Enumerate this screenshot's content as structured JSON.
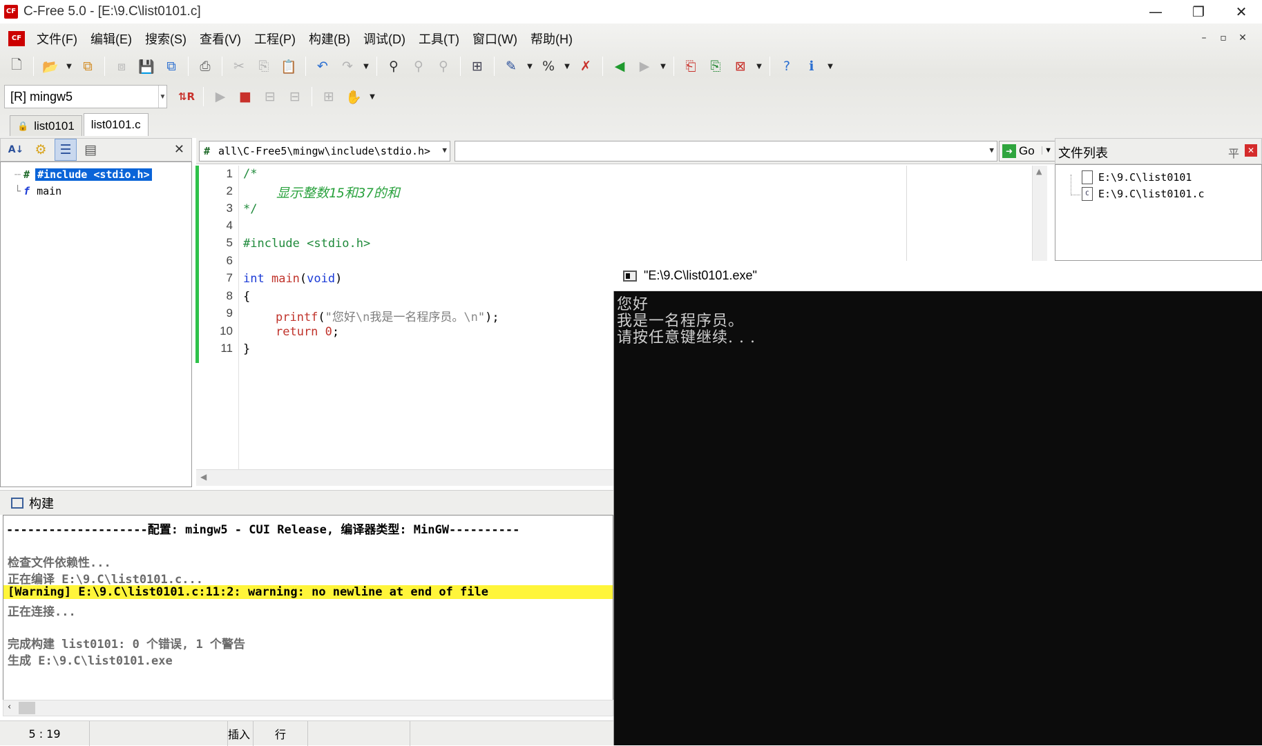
{
  "window": {
    "title": "C-Free 5.0 - [E:\\9.C\\list0101.c]",
    "app_icon": "CF",
    "minimize_glyph": "—",
    "restore_glyph": "❐",
    "close_glyph": "✕"
  },
  "menu": {
    "items": [
      "文件(F)",
      "编辑(E)",
      "搜索(S)",
      "查看(V)",
      "工程(P)",
      "构建(B)",
      "调试(D)",
      "工具(T)",
      "窗口(W)",
      "帮助(H)"
    ],
    "mdi_buttons": [
      "–",
      "▫",
      "✕"
    ]
  },
  "toolbar2": {
    "compiler_value": "[R] mingw5"
  },
  "tabs": [
    {
      "label": "list0101",
      "locked": true
    },
    {
      "label": "list0101.c",
      "locked": false
    }
  ],
  "class_view": {
    "items": [
      {
        "glyph": "#",
        "label": "#include <stdio.h>",
        "selected": true
      },
      {
        "glyph": "f",
        "label": "main",
        "selected": false
      }
    ]
  },
  "editor_header": {
    "include_path": "all\\C-Free5\\mingw\\include\\stdio.h>",
    "symbol_value": "",
    "go_label": "Go"
  },
  "editor": {
    "line_numbers": [
      "1",
      "2",
      "3",
      "4",
      "5",
      "6",
      "7",
      "8",
      "9",
      "10",
      "11"
    ],
    "lines": {
      "l1": "/*",
      "l2": "显示整数15和37的和",
      "l3": "*/",
      "l5": "#include <stdio.h>",
      "l7_kw": "int",
      "l7_fn": "main",
      "l7_paren_open": "(",
      "l7_void": "void",
      "l7_paren_close": ")",
      "l8": "{",
      "l9_fn": "printf",
      "l9_open": "(",
      "l9_str1": "\"您好",
      "l9_esc1": "\\n",
      "l9_str2": "我是一名程序员。",
      "l9_esc2": "\\n",
      "l9_str3": "\"",
      "l9_close": ");",
      "l10_kw": "return",
      "l10_num": "0",
      "l10_semi": ";",
      "l11": "}"
    }
  },
  "file_list": {
    "title": "文件列表",
    "pin_glyph": "平",
    "close_glyph": "✕",
    "files": [
      {
        "icon": "",
        "path": "E:\\9.C\\list0101"
      },
      {
        "icon": "C",
        "path": "E:\\9.C\\list0101.c"
      }
    ]
  },
  "build": {
    "title": "构建",
    "lines": {
      "config": "--------------------配置: mingw5 - CUI Release, 编译器类型: MinGW----------",
      "check": "检查文件依赖性...",
      "compiling": "正在编译 E:\\9.C\\list0101.c...",
      "warning": "[Warning] E:\\9.C\\list0101.c:11:2: warning: no newline at end of file",
      "linking": "正在连接...",
      "done": "完成构建 list0101: 0 个错误, 1 个警告",
      "output": "生成 E:\\9.C\\list0101.exe"
    }
  },
  "status": {
    "position": "5 : 19",
    "mode": "插入",
    "line_label": "行"
  },
  "console": {
    "title": "\"E:\\9.C\\list0101.exe\"",
    "lines": [
      "您好",
      "我是一名程序员。",
      "请按任意键继续. . ."
    ]
  },
  "colors": {
    "selection": "#0a64d8",
    "warning_highlight": "#fff53a",
    "comment": "#1f8a3b",
    "keyword": "#1b3bd6",
    "function": "#c0332b",
    "console_bg": "#0c0c0c",
    "modified_bar": "#2fc24a"
  }
}
